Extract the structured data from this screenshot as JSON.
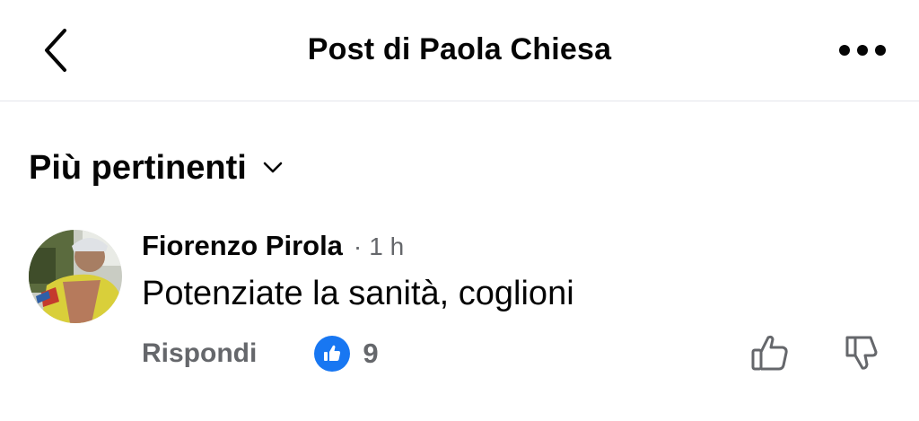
{
  "header": {
    "title": "Post di Paola Chiesa",
    "back_icon": "chevron-left-icon",
    "more_icon": "more-horizontal-icon"
  },
  "sort": {
    "label": "Più pertinenti",
    "icon": "chevron-down-icon"
  },
  "comment": {
    "author": "Fiorenzo Pirola",
    "separator": "·",
    "time": "1 h",
    "text": "Potenziate la sanità, coglioni",
    "reply_label": "Rispondi",
    "reaction_count": "9",
    "reaction_icon": "like-reaction-icon",
    "upvote_icon": "thumbs-up-outline-icon",
    "downvote_icon": "thumbs-down-outline-icon"
  },
  "colors": {
    "text": "#050505",
    "secondary": "#65676b",
    "accent": "#1877f2",
    "divider": "#e4e6eb"
  }
}
